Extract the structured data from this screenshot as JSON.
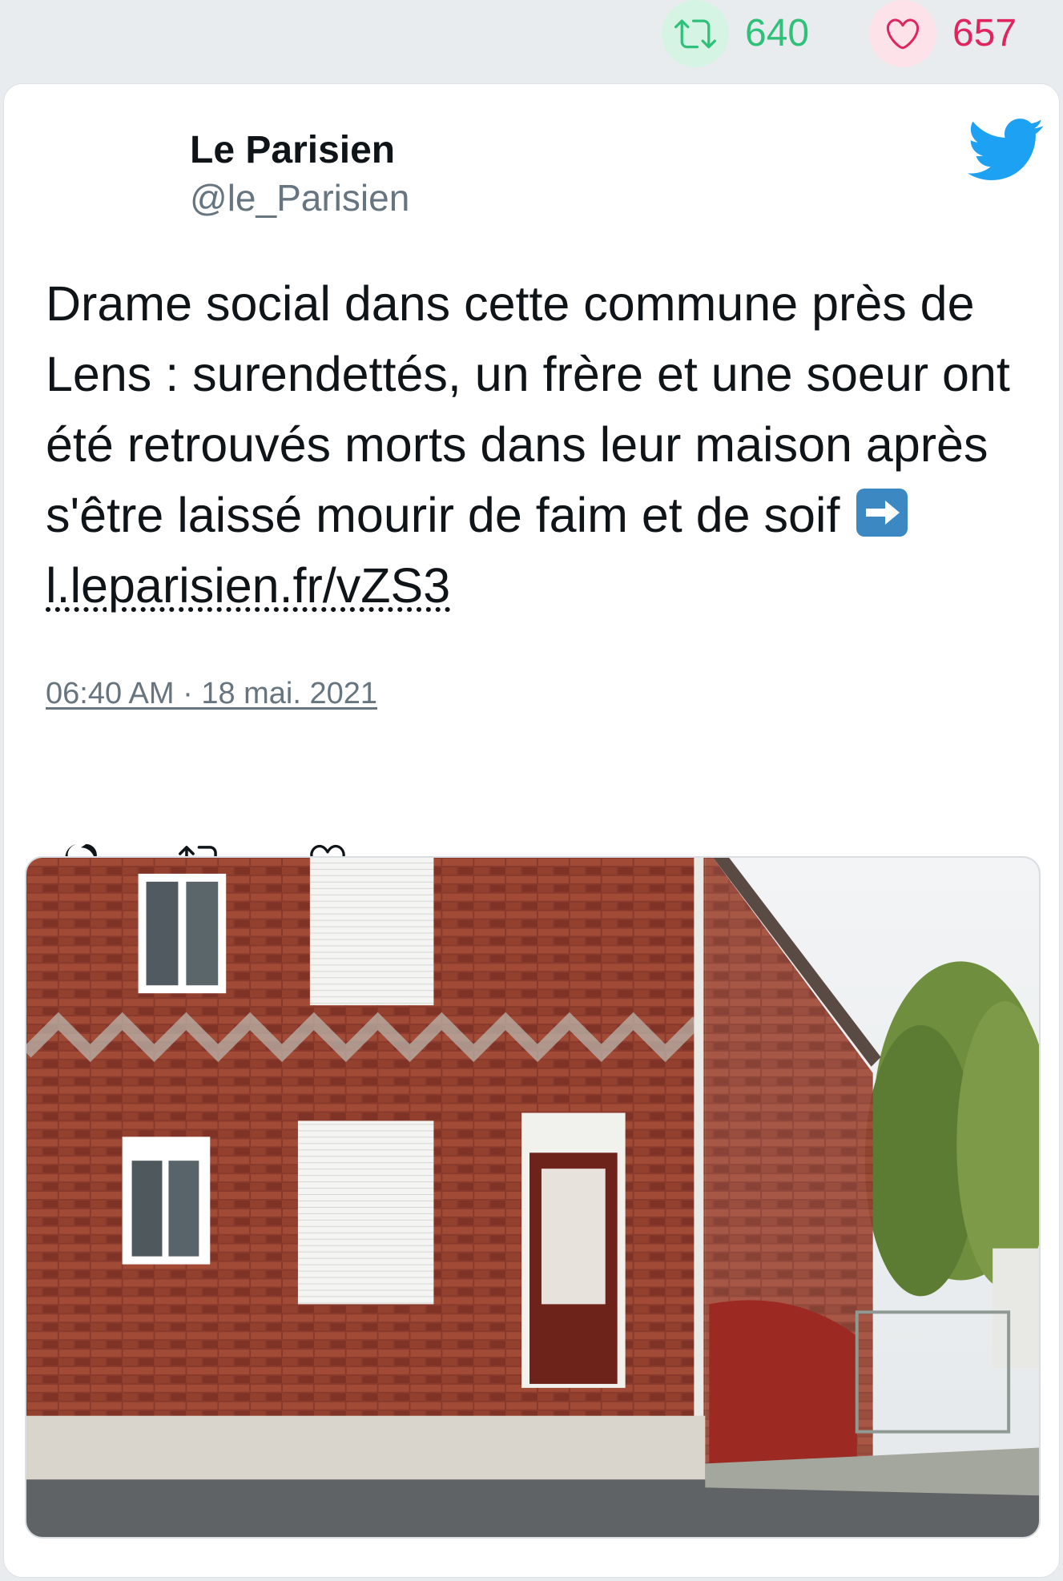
{
  "stats": {
    "retweets": "640",
    "likes": "657",
    "colors": {
      "retweet": "#2fc07a",
      "like": "#e0245e"
    }
  },
  "tweet": {
    "author_name": "Le Parisien",
    "author_handle": "@le_Parisien",
    "text": "Drame social dans cette commune près de Lens : surendettés, un frère et une soeur ont été retrouvés morts dans leur maison après s'être laissé mourir de faim et de soif",
    "emoji": "right-arrow-emoji",
    "link": "l.leparisien.fr/vZS3",
    "timestamp": "06:40 AM · 18 mai. 2021",
    "brand_icon": "twitter-bird-icon",
    "brand_color": "#1da1f2"
  },
  "actions": [
    {
      "name": "reply",
      "icon": "reply-icon"
    },
    {
      "name": "retweet",
      "icon": "retweet-icon"
    },
    {
      "name": "like",
      "icon": "heart-icon"
    }
  ],
  "media": {
    "type": "photo",
    "subject": "red-brick-house-photo"
  }
}
